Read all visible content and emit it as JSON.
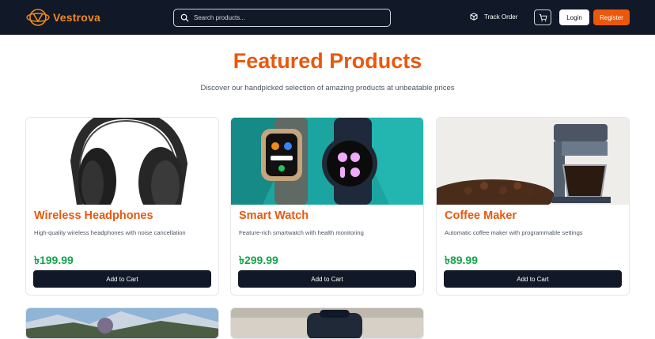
{
  "brand": {
    "name": "Vestrova"
  },
  "nav": {
    "search_placeholder": "Search products...",
    "track_order_label": "Track Order",
    "login_label": "Login",
    "register_label": "Register"
  },
  "hero": {
    "title": "Featured Products",
    "subtitle": "Discover our handpicked selection of amazing products at unbeatable prices"
  },
  "products": [
    {
      "name": "Wireless Headphones",
      "description": "High-quality wireless headphones with noise cancellation",
      "price": "৳199.99",
      "button_label": "Add to Cart",
      "image": "headphones-image"
    },
    {
      "name": "Smart Watch",
      "description": "Feature-rich smartwatch with health monitoring",
      "price": "৳299.99",
      "button_label": "Add to Cart",
      "image": "smartwatch-image"
    },
    {
      "name": "Coffee Maker",
      "description": "Automatic coffee maker with programmable settings",
      "price": "৳89.99",
      "button_label": "Add to Cart",
      "image": "coffee-maker-image"
    }
  ],
  "partial_products": [
    {
      "image": "mountain-landscape-image"
    },
    {
      "image": "backpack-image"
    }
  ],
  "colors": {
    "navbar_bg": "#111827",
    "accent": "#ea580c",
    "price": "#16a34a",
    "button_dark": "#111827"
  }
}
